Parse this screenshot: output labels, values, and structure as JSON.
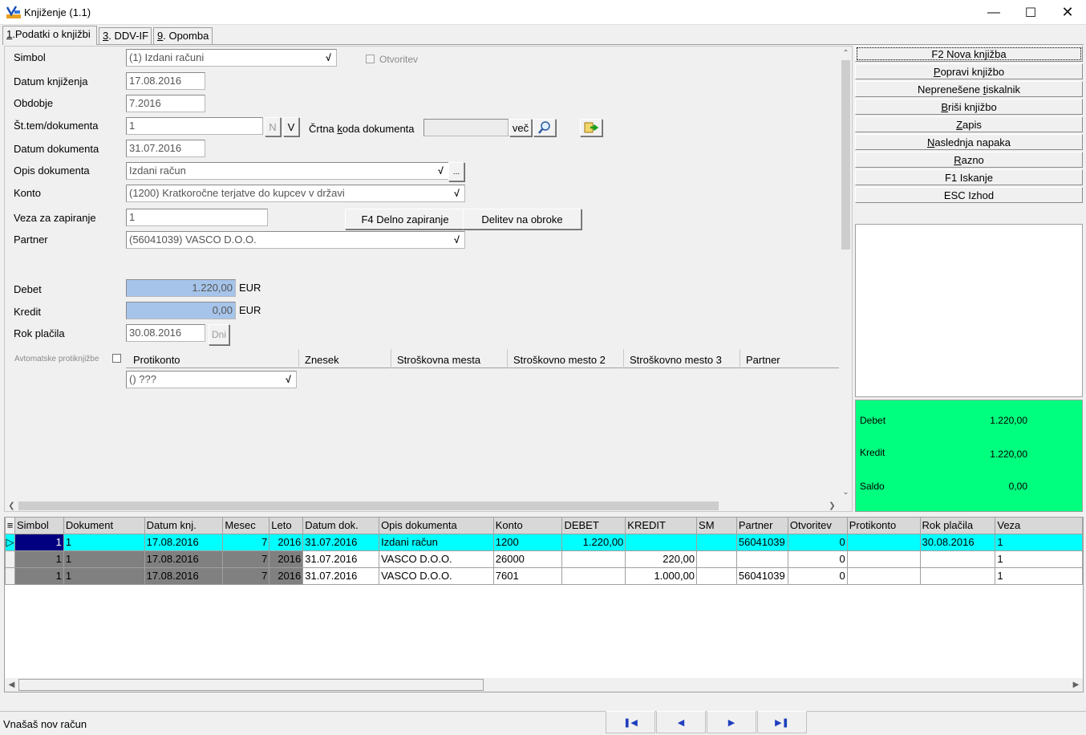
{
  "window": {
    "title": "Knjiženje  (1.1)"
  },
  "tabs": [
    {
      "key": "1",
      "label": ".Podatki o knjižbi"
    },
    {
      "key": "3",
      "label": ". DDV-IF"
    },
    {
      "key": "9",
      "label": ". Opomba"
    }
  ],
  "form": {
    "simbol": {
      "label": "Simbol",
      "value": "(1) Izdani računi"
    },
    "otvoritev": {
      "label": "Otvoritev"
    },
    "datum_knjizenja": {
      "label": "Datum knjiženja",
      "value": "17.08.2016"
    },
    "obdobje": {
      "label": "Obdobje",
      "value": "7.2016"
    },
    "st_dokumenta": {
      "label": "Št.tem/dokumenta",
      "value": "1",
      "btn_n": "N",
      "btn_v": "V"
    },
    "crtna_koda": {
      "label_pre": "Črtna ",
      "label_key": "k",
      "label_post": "oda dokumenta",
      "value": "",
      "btn_vec": "več"
    },
    "datum_dokumenta": {
      "label": "Datum dokumenta",
      "value": "31.07.2016"
    },
    "opis_dokumenta": {
      "label": "Opis dokumenta",
      "value": "Izdani račun",
      "btn_more": "..."
    },
    "konto": {
      "label": "Konto",
      "value": "(1200) Kratkoročne terjatve do kupcev v državi"
    },
    "veza": {
      "label": "Veza za zapiranje",
      "value": "1",
      "btn_delno": "F4 Delno zapiranje",
      "btn_obroki": "Delitev na obroke"
    },
    "partner": {
      "label": "Partner",
      "value": "(56041039) VASCO D.O.O."
    },
    "debet": {
      "label": "Debet",
      "value": "1.220,00",
      "currency": "EUR"
    },
    "kredit": {
      "label": "Kredit",
      "value": "0,00",
      "currency": "EUR"
    },
    "rok_placila": {
      "label": "Rok plačila",
      "value": "30.08.2016",
      "btn_dni": "Dni"
    },
    "avto_protiknjizbe": {
      "label": "Avtomatske protiknjižbe"
    },
    "proti_headers": [
      "Protikonto",
      "Znesek",
      "Stroškovna mesta",
      "Stroškovno mesto 2",
      "Stroškovno mesto 3",
      "Partner"
    ],
    "protikonto_value": "() ???"
  },
  "right_buttons": [
    {
      "pre": "F2 Nova knjižba",
      "key": "",
      "post": ""
    },
    {
      "pre": "",
      "key": "P",
      "post": "opravi knjižbo"
    },
    {
      "pre": "Neprenešene ",
      "key": "t",
      "post": "iskalnik"
    },
    {
      "pre": "",
      "key": "B",
      "post": "riši knjižbo"
    },
    {
      "pre": "",
      "key": "Z",
      "post": "apis"
    },
    {
      "pre": "",
      "key": "N",
      "post": "aslednja napaka"
    },
    {
      "pre": "",
      "key": "R",
      "post": "azno"
    },
    {
      "pre": "F1 Iskanje",
      "key": "",
      "post": ""
    },
    {
      "pre": "ESC Izhod",
      "key": "",
      "post": ""
    }
  ],
  "totals": {
    "debet_label": "Debet",
    "debet_value": "1.220,00",
    "kredit_label": "Kredit",
    "kredit_value": "1.220,00",
    "saldo_label": "Saldo",
    "saldo_value": "0,00"
  },
  "grid": {
    "columns": [
      "Simbol",
      "Dokument",
      "Datum knj.",
      "Mesec",
      "Leto",
      "Datum dok.",
      "Opis dokumenta",
      "Konto",
      "DEBET",
      "KREDIT",
      "SM",
      "Partner",
      "Otvoritev",
      "Protikonto",
      "Rok plačila",
      "Veza"
    ],
    "rows": [
      [
        "1",
        "1",
        "17.08.2016",
        "7",
        "2016",
        "31.07.2016",
        "Izdani račun",
        "1200",
        "1.220,00",
        "",
        "",
        "56041039",
        "0",
        "",
        "30.08.2016",
        "1"
      ],
      [
        "1",
        "1",
        "17.08.2016",
        "7",
        "2016",
        "31.07.2016",
        "VASCO D.O.O.",
        "26000",
        "",
        "220,00",
        "",
        "",
        "0",
        "",
        "",
        "1"
      ],
      [
        "1",
        "1",
        "17.08.2016",
        "7",
        "2016",
        "31.07.2016",
        "VASCO D.O.O.",
        "7601",
        "",
        "1.000,00",
        "",
        "56041039",
        "0",
        "",
        "",
        "1"
      ]
    ]
  },
  "status": {
    "text": "Vnašaš nov račun"
  },
  "colors": {
    "selected_row": "#00ffff",
    "totals_bg": "#00ff7f",
    "amount_field": "#a6c4ea",
    "key_cell": "#000080"
  },
  "icons": [
    "app-icon",
    "minimize-icon",
    "maximize-icon",
    "close-icon",
    "search-icon",
    "export-icon",
    "first-record-icon",
    "prev-record-icon",
    "next-record-icon",
    "last-record-icon"
  ]
}
